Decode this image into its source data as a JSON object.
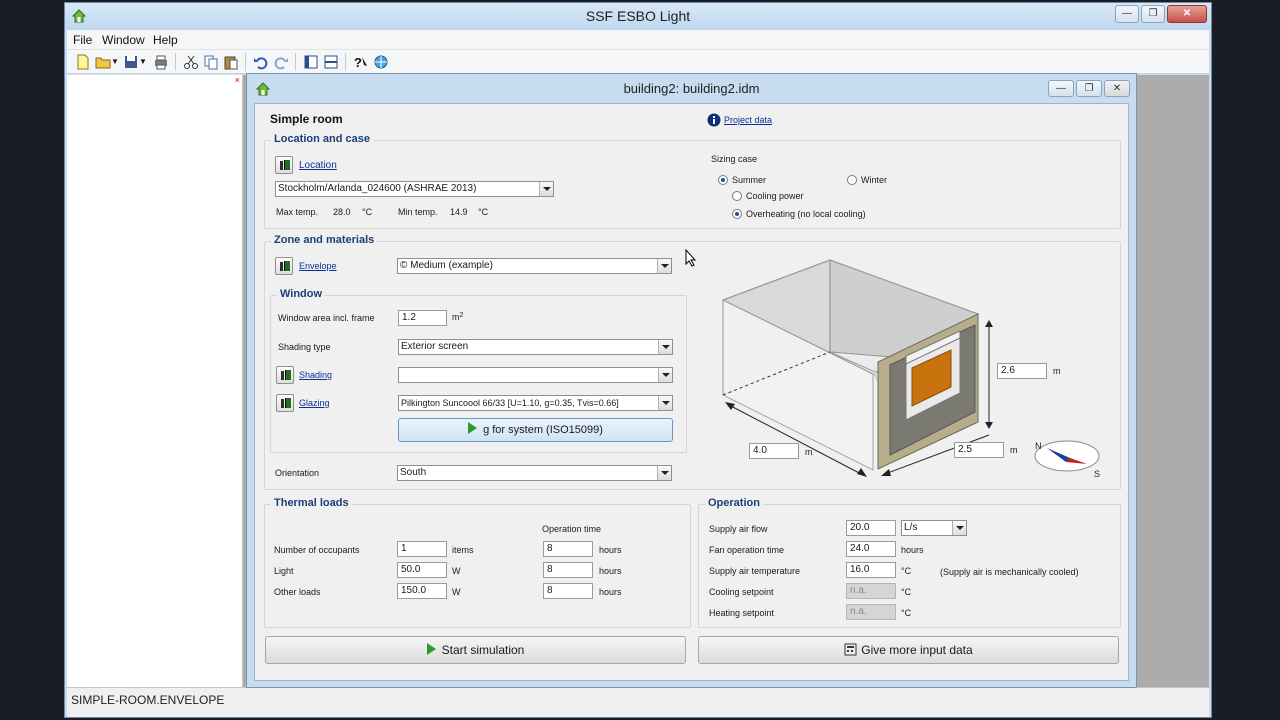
{
  "app": {
    "title": "SSF ESBO Light",
    "menu": [
      "File",
      "Window",
      "Help"
    ],
    "toolbar_icons": [
      "new-file-icon",
      "open-folder-icon",
      "save-icon",
      "print-icon",
      "cut-icon",
      "copy-icon",
      "paste-icon",
      "undo-icon",
      "redo-icon",
      "tile-vertical-icon",
      "tile-horizontal-icon",
      "help-icon",
      "globe-icon"
    ],
    "status": "SIMPLE-ROOM.ENVELOPE"
  },
  "document": {
    "title": "building2: building2.idm",
    "page_title": "Simple room",
    "project_data_link": "Project data"
  },
  "location_case": {
    "group_title": "Location and case",
    "location_link": "Location",
    "location_value": "Stockholm/Arlanda_024600 (ASHRAE 2013)",
    "max_temp_label": "Max temp.",
    "max_temp_value": "28.0",
    "max_temp_unit": "°C",
    "min_temp_label": "Min temp.",
    "min_temp_value": "14.9",
    "min_temp_unit": "°C",
    "sizing_case_label": "Sizing case",
    "summer": "Summer",
    "winter": "Winter",
    "cooling_power": "Cooling power",
    "overheating": "Overheating (no local cooling)"
  },
  "zone": {
    "group_title": "Zone and materials",
    "envelope_link": "Envelope",
    "envelope_value": "© Medium (example)",
    "window_group_title": "Window",
    "window_area_label": "Window area incl. frame",
    "window_area_value": "1.2",
    "window_area_unit": "m",
    "window_area_sup": "2",
    "shading_type_label": "Shading type",
    "shading_type_value": "Exterior screen",
    "shading_link": "Shading",
    "shading_value": "",
    "glazing_link": "Glazing",
    "glazing_value": "Pilkington Suncoool 66/33 [U=1.10, g=0.35, Tvis=0.66]",
    "g_button": "g for system (ISO15099)",
    "orientation_label": "Orientation",
    "orientation_value": "South",
    "height_value": "2.6",
    "length_value": "4.0",
    "width_value": "2.5",
    "dim_unit": "m",
    "compass_n": "N",
    "compass_s": "S"
  },
  "thermal": {
    "group_title": "Thermal loads",
    "operation_time_header": "Operation time",
    "rows": [
      {
        "label": "Number of occupants",
        "value": "1",
        "unit": "items",
        "time": "8",
        "time_unit": "hours"
      },
      {
        "label": "Light",
        "value": "50.0",
        "unit": "W",
        "time": "8",
        "time_unit": "hours"
      },
      {
        "label": "Other loads",
        "value": "150.0",
        "unit": "W",
        "time": "8",
        "time_unit": "hours"
      }
    ]
  },
  "operation": {
    "group_title": "Operation",
    "supply_flow_label": "Supply air flow",
    "supply_flow_value": "20.0",
    "supply_flow_unit": "L/s",
    "fan_time_label": "Fan operation time",
    "fan_time_value": "24.0",
    "fan_time_unit": "hours",
    "supply_temp_label": "Supply air temperature",
    "supply_temp_value": "16.0",
    "supply_temp_unit": "°C",
    "supply_note": "(Supply air is mechanically cooled)",
    "cooling_setpoint_label": "Cooling setpoint",
    "cooling_setpoint_value": "n.a.",
    "cooling_setpoint_unit": "°C",
    "heating_setpoint_label": "Heating setpoint",
    "heating_setpoint_value": "n.a.",
    "heating_setpoint_unit": "°C"
  },
  "actions": {
    "start": "Start simulation",
    "more": "Give more input data"
  }
}
